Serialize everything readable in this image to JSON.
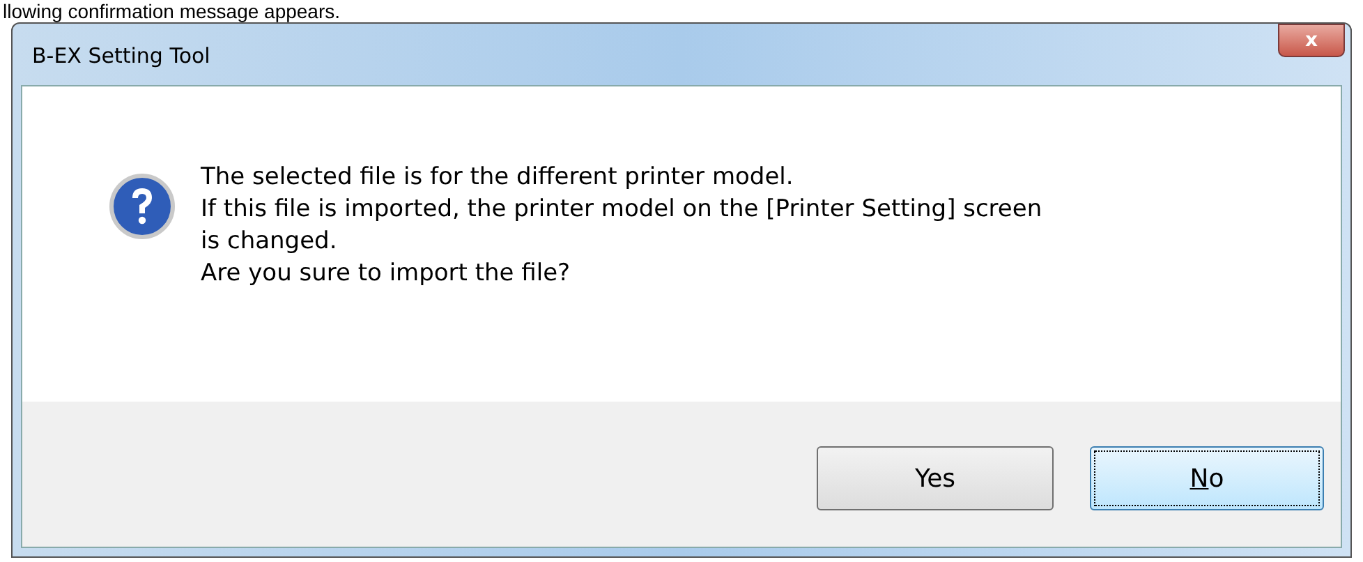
{
  "page_text": "llowing confirmation message appears.",
  "window": {
    "title": "B-EX Setting Tool",
    "close": "x"
  },
  "message": {
    "lines": [
      "The selected file is for the different printer model.",
      "If this file is imported, the printer model on the [Printer Setting] screen",
      "is changed.",
      "Are you sure to import the file?"
    ]
  },
  "buttons": [
    {
      "label": "Yes",
      "focused": false
    },
    {
      "label": "o",
      "mnemonic": "N",
      "focused": true
    }
  ]
}
